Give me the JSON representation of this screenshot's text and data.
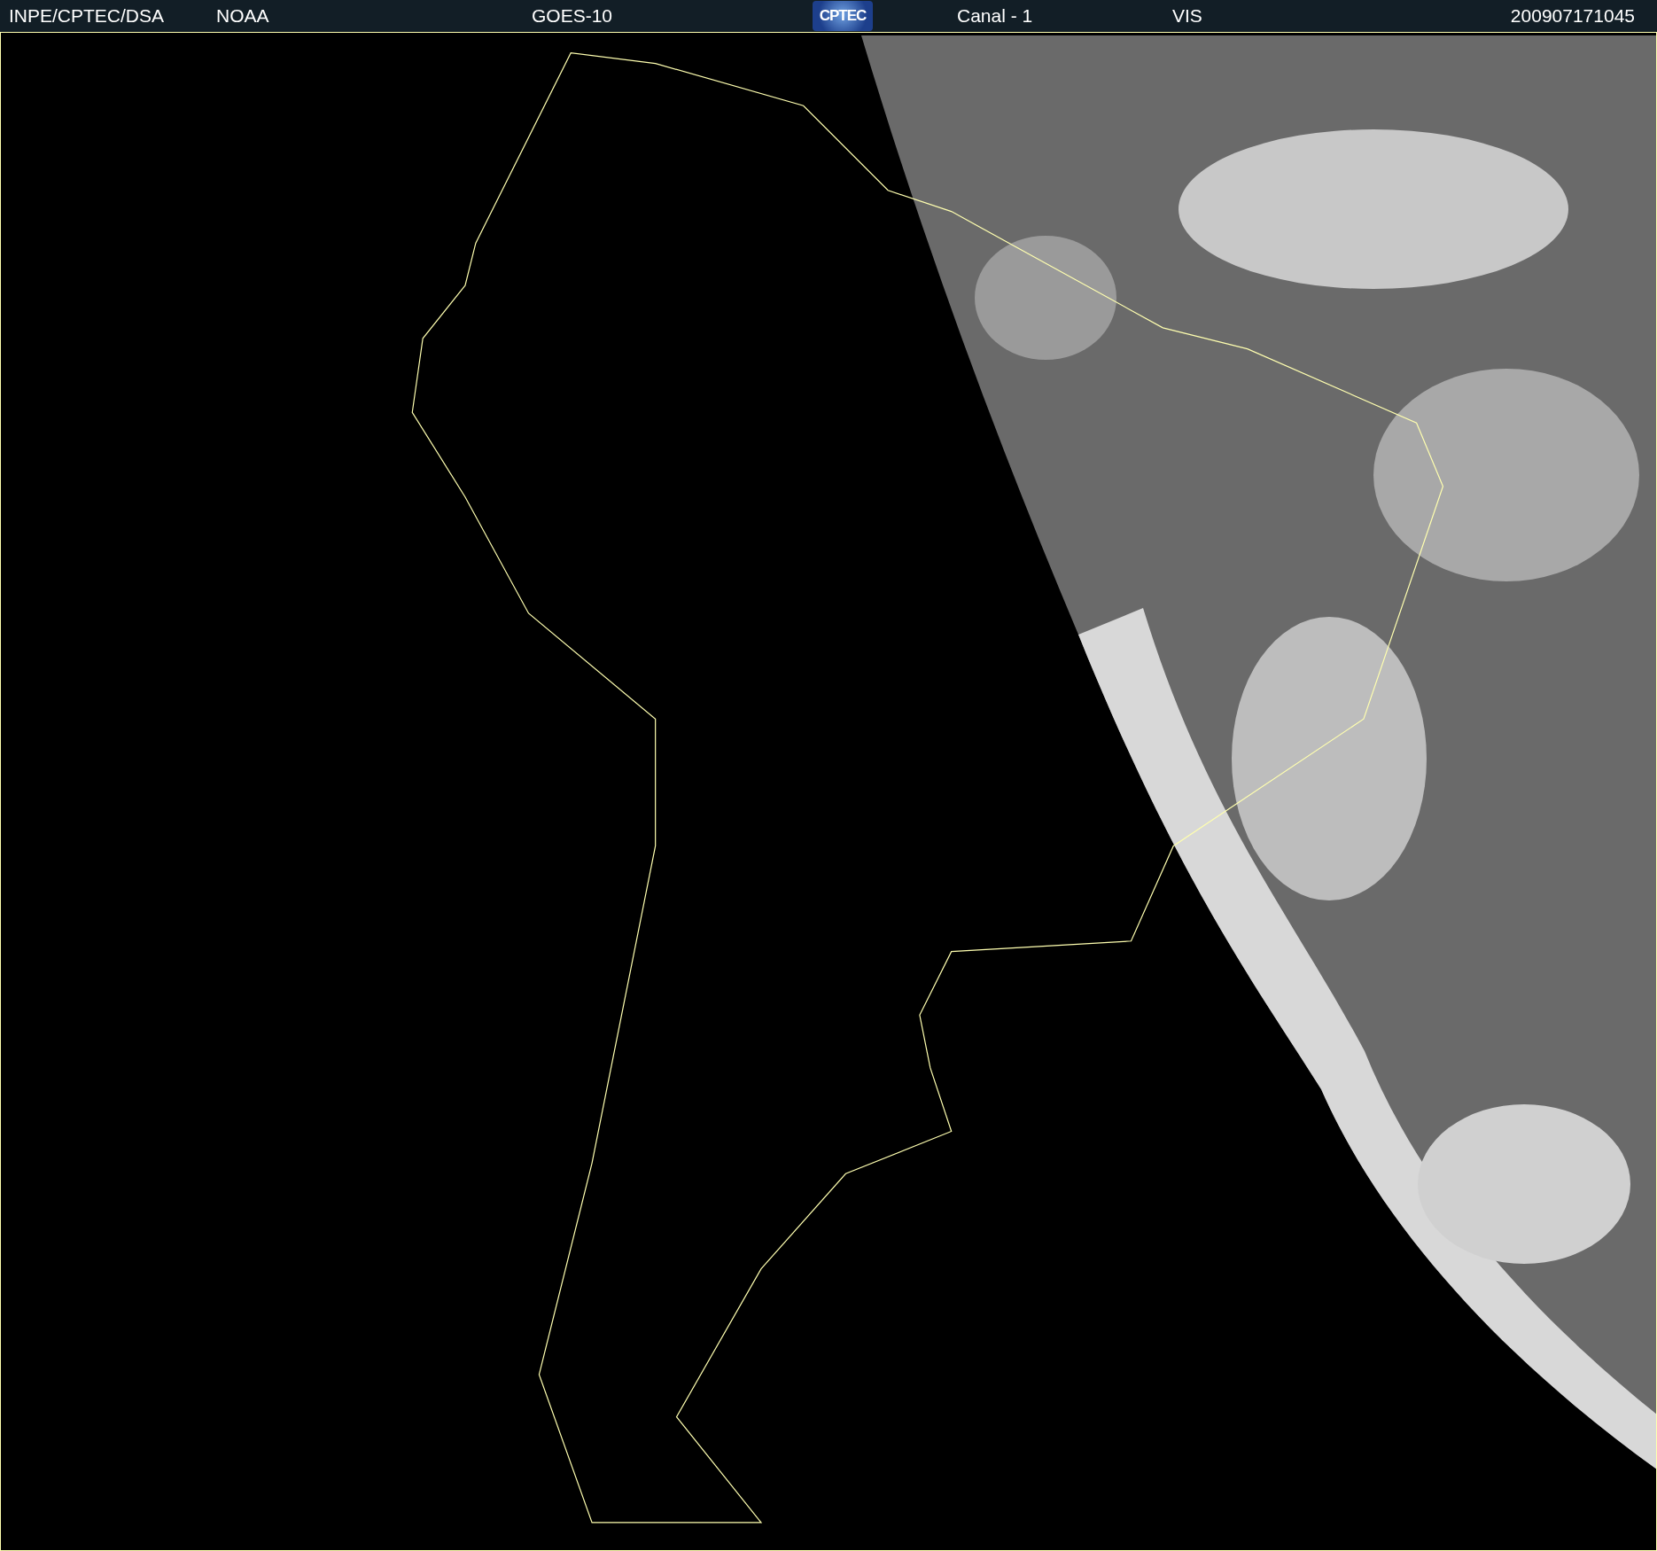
{
  "header": {
    "source": "INPE/CPTEC/DSA",
    "agency": "NOAA",
    "satellite": "GOES-10",
    "logo": "CPTEC",
    "channel": "Canal - 1",
    "band": "VIS",
    "timestamp": "200907171045"
  }
}
